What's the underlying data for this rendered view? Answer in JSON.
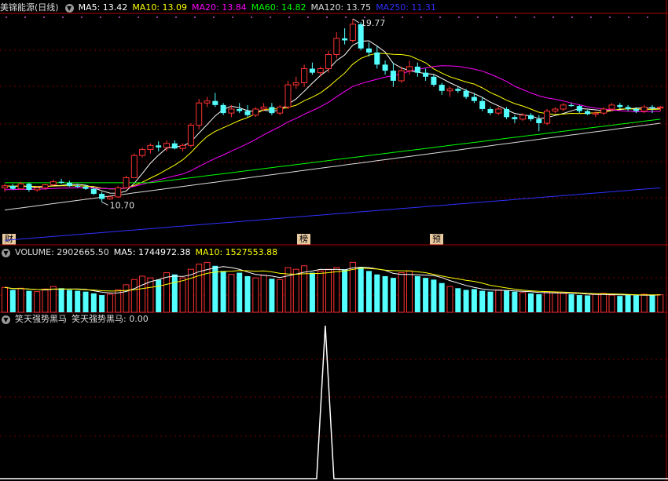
{
  "price_panel": {
    "title": "美锦能源(日线)",
    "ma_legend": [
      {
        "label": "MA5: 13.42",
        "color": "#ffffff"
      },
      {
        "label": "MA10: 13.09",
        "color": "#ffff00"
      },
      {
        "label": "MA20: 13.84",
        "color": "#ff00ff"
      },
      {
        "label": "MA60: 14.82",
        "color": "#00ff00"
      },
      {
        "label": "MA120: 13.75",
        "color": "#dddddd"
      },
      {
        "label": "MA250: 11.31",
        "color": "#3030ff"
      }
    ],
    "high_label": "19.77",
    "low_label": "10.70",
    "markers": [
      "财",
      "榜",
      "预"
    ]
  },
  "volume_panel": {
    "label": "VOLUME: 2902665.50",
    "ma5": "MA5: 1744972.38",
    "ma10": "MA10: 1527553.88"
  },
  "indicator_panel": {
    "name": "笑天强势黑马",
    "value_label": "笑天强势黑马: 0.00"
  },
  "colors": {
    "up": "#ff3232",
    "down": "#54ffff",
    "grid": "#8b0000"
  },
  "chart_data": {
    "type": "candlestick",
    "series": [
      {
        "name": "MA5",
        "values": []
      },
      {
        "name": "MA10",
        "values": []
      },
      {
        "name": "MA20",
        "values": []
      },
      {
        "name": "MA60",
        "values": []
      },
      {
        "name": "MA120",
        "values": []
      },
      {
        "name": "MA250",
        "values": []
      }
    ],
    "ohlc": [
      [
        11.4,
        11.6,
        11.2,
        11.5
      ],
      [
        11.5,
        11.6,
        11.3,
        11.35
      ],
      [
        11.35,
        11.7,
        11.3,
        11.6
      ],
      [
        11.6,
        11.65,
        11.2,
        11.3
      ],
      [
        11.3,
        11.45,
        11.2,
        11.4
      ],
      [
        11.4,
        11.6,
        11.3,
        11.55
      ],
      [
        11.55,
        11.8,
        11.5,
        11.7
      ],
      [
        11.7,
        11.85,
        11.6,
        11.65
      ],
      [
        11.65,
        11.75,
        11.45,
        11.5
      ],
      [
        11.5,
        11.6,
        11.4,
        11.45
      ],
      [
        11.45,
        11.55,
        11.3,
        11.35
      ],
      [
        11.35,
        11.4,
        11.05,
        11.1
      ],
      [
        11.1,
        11.2,
        10.7,
        10.85
      ],
      [
        10.85,
        11.0,
        10.8,
        10.95
      ],
      [
        10.95,
        11.5,
        10.9,
        11.4
      ],
      [
        11.4,
        12.0,
        11.35,
        11.9
      ],
      [
        11.9,
        13.1,
        11.9,
        13.0
      ],
      [
        13.0,
        13.4,
        12.9,
        13.3
      ],
      [
        13.3,
        13.6,
        13.1,
        13.5
      ],
      [
        13.5,
        13.7,
        13.2,
        13.4
      ],
      [
        13.4,
        13.75,
        13.2,
        13.6
      ],
      [
        13.6,
        13.75,
        13.3,
        13.35
      ],
      [
        13.35,
        13.6,
        13.2,
        13.5
      ],
      [
        13.5,
        14.6,
        13.4,
        14.5
      ],
      [
        14.5,
        15.8,
        14.3,
        15.6
      ],
      [
        15.6,
        15.9,
        15.4,
        15.7
      ],
      [
        15.7,
        16.1,
        15.4,
        15.5
      ],
      [
        15.5,
        15.6,
        15.0,
        15.1
      ],
      [
        15.1,
        15.5,
        14.9,
        15.3
      ],
      [
        15.3,
        15.6,
        15.1,
        15.2
      ],
      [
        15.2,
        15.5,
        14.9,
        15.0
      ],
      [
        15.0,
        15.4,
        14.9,
        15.3
      ],
      [
        15.3,
        15.6,
        15.2,
        15.4
      ],
      [
        15.4,
        15.6,
        15.0,
        15.1
      ],
      [
        15.1,
        15.5,
        15.0,
        15.4
      ],
      [
        15.4,
        16.7,
        15.3,
        16.5
      ],
      [
        16.5,
        16.9,
        16.3,
        16.6
      ],
      [
        16.6,
        17.5,
        16.4,
        17.3
      ],
      [
        17.3,
        17.6,
        17.0,
        17.1
      ],
      [
        17.1,
        17.4,
        16.9,
        17.3
      ],
      [
        17.3,
        18.2,
        17.1,
        18.0
      ],
      [
        18.0,
        19.1,
        17.8,
        18.8
      ],
      [
        18.8,
        19.3,
        18.5,
        18.7
      ],
      [
        18.7,
        19.77,
        18.6,
        19.5
      ],
      [
        19.5,
        19.6,
        18.2,
        18.3
      ],
      [
        18.3,
        18.6,
        17.9,
        18.1
      ],
      [
        18.1,
        18.4,
        17.3,
        17.5
      ],
      [
        17.5,
        17.7,
        17.0,
        17.2
      ],
      [
        17.2,
        17.6,
        16.4,
        16.7
      ],
      [
        16.7,
        17.4,
        16.6,
        17.2
      ],
      [
        17.2,
        17.7,
        17.0,
        17.4
      ],
      [
        17.4,
        17.6,
        16.9,
        17.1
      ],
      [
        17.1,
        17.3,
        16.7,
        16.9
      ],
      [
        16.9,
        17.0,
        16.4,
        16.5
      ],
      [
        16.5,
        16.6,
        16.0,
        16.2
      ],
      [
        16.2,
        16.4,
        15.9,
        16.3
      ],
      [
        16.3,
        16.4,
        16.1,
        16.2
      ],
      [
        16.2,
        16.3,
        15.8,
        15.9
      ],
      [
        15.9,
        16.1,
        15.6,
        15.7
      ],
      [
        15.7,
        15.9,
        15.2,
        15.3
      ],
      [
        15.3,
        15.4,
        15.0,
        15.1
      ],
      [
        15.1,
        15.4,
        15.0,
        15.3
      ],
      [
        15.3,
        15.4,
        14.8,
        14.9
      ],
      [
        14.9,
        15.0,
        14.6,
        14.8
      ],
      [
        14.8,
        15.1,
        14.7,
        15.0
      ],
      [
        15.0,
        15.1,
        14.7,
        14.8
      ],
      [
        14.8,
        15.0,
        14.2,
        14.6
      ],
      [
        14.6,
        15.3,
        14.5,
        15.2
      ],
      [
        15.2,
        15.4,
        15.1,
        15.3
      ],
      [
        15.3,
        15.6,
        15.2,
        15.5
      ],
      [
        15.5,
        15.6,
        15.4,
        15.45
      ],
      [
        15.45,
        15.5,
        15.1,
        15.2
      ],
      [
        15.2,
        15.25,
        15.0,
        15.05
      ],
      [
        15.05,
        15.2,
        14.9,
        15.1
      ],
      [
        15.1,
        15.4,
        15.0,
        15.3
      ],
      [
        15.3,
        15.6,
        15.2,
        15.5
      ],
      [
        15.5,
        15.6,
        15.3,
        15.4
      ],
      [
        15.4,
        15.5,
        15.2,
        15.3
      ],
      [
        15.3,
        15.4,
        15.1,
        15.2
      ],
      [
        15.2,
        15.5,
        15.1,
        15.4
      ],
      [
        15.4,
        15.5,
        15.1,
        15.35
      ],
      [
        15.35,
        15.45,
        15.2,
        15.4
      ]
    ],
    "volume": [
      1450000,
      1300000,
      1400000,
      1250000,
      1200000,
      1350000,
      1500000,
      1400000,
      1300000,
      1250000,
      1200000,
      1100000,
      1000000,
      1050000,
      1300000,
      1600000,
      1900000,
      2100000,
      2000000,
      1900000,
      2300000,
      2200000,
      2000000,
      2500000,
      2800000,
      2900000,
      2700000,
      2400000,
      2200000,
      2300000,
      2100000,
      2000000,
      2150000,
      1950000,
      1900000,
      2600000,
      2500000,
      2700000,
      2300000,
      2400000,
      2500000,
      2600000,
      2500000,
      2902665,
      2600000,
      2400000,
      2200000,
      2100000,
      2000000,
      2300000,
      2400000,
      2100000,
      2000000,
      1900000,
      1700000,
      1500000,
      1400000,
      1300000,
      1350000,
      1250000,
      1200000,
      1300000,
      1250000,
      1200000,
      1150000,
      1100000,
      1050000,
      1200000,
      1150000,
      1100000,
      1050000,
      1000000,
      980000,
      1050000,
      1100000,
      1000000,
      950000,
      1000000,
      980000,
      1050000,
      1000000,
      1020000
    ],
    "signal_index": 43,
    "signal_value": 1
  }
}
